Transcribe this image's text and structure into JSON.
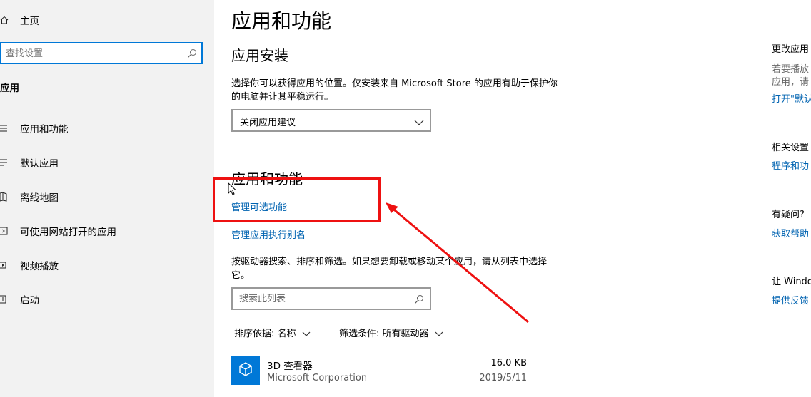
{
  "sidebar": {
    "home_label": "主页",
    "search_placeholder": "查找设置",
    "section_title": "应用",
    "items": [
      {
        "label": "应用和功能",
        "icon": "list-icon"
      },
      {
        "label": "默认应用",
        "icon": "default-apps-icon"
      },
      {
        "label": "离线地图",
        "icon": "map-icon"
      },
      {
        "label": "可使用网站打开的应用",
        "icon": "web-app-icon"
      },
      {
        "label": "视频播放",
        "icon": "video-icon"
      },
      {
        "label": "启动",
        "icon": "startup-icon"
      }
    ]
  },
  "main": {
    "title": "应用和功能",
    "install": {
      "heading": "应用安装",
      "description": "选择你可以获得应用的位置。仅安装来自 Microsoft Store 的应用有助于保护你的电脑并让其平稳运行。",
      "dropdown_value": "关闭应用建议"
    },
    "apps": {
      "heading": "应用和功能",
      "link_optional_features": "管理可选功能",
      "link_aliases": "管理应用执行别名",
      "description": "按驱动器搜索、排序和筛选。如果想要卸载或移动某个应用，请从列表中选择它。",
      "search_placeholder": "搜索此列表",
      "sort_label": "排序依据: 名称",
      "filter_label": "筛选条件: 所有驱动器",
      "list": [
        {
          "name": "3D 查看器",
          "publisher": "Microsoft Corporation",
          "size": "16.0 KB",
          "date": "2019/5/11"
        }
      ]
    }
  },
  "right_panel": {
    "heading1": "更改应用",
    "text1a": "若要播放",
    "text1b": "应用，请",
    "link1": "打开\"默认",
    "heading2": "相关设置",
    "link2": "程序和功",
    "heading3": "有疑问?",
    "link3": "获取帮助",
    "heading4": "让 Windo",
    "link4": "提供反馈"
  },
  "colors": {
    "accent": "#0078d7",
    "link": "#0063b1",
    "annotation": "#ee1111"
  }
}
